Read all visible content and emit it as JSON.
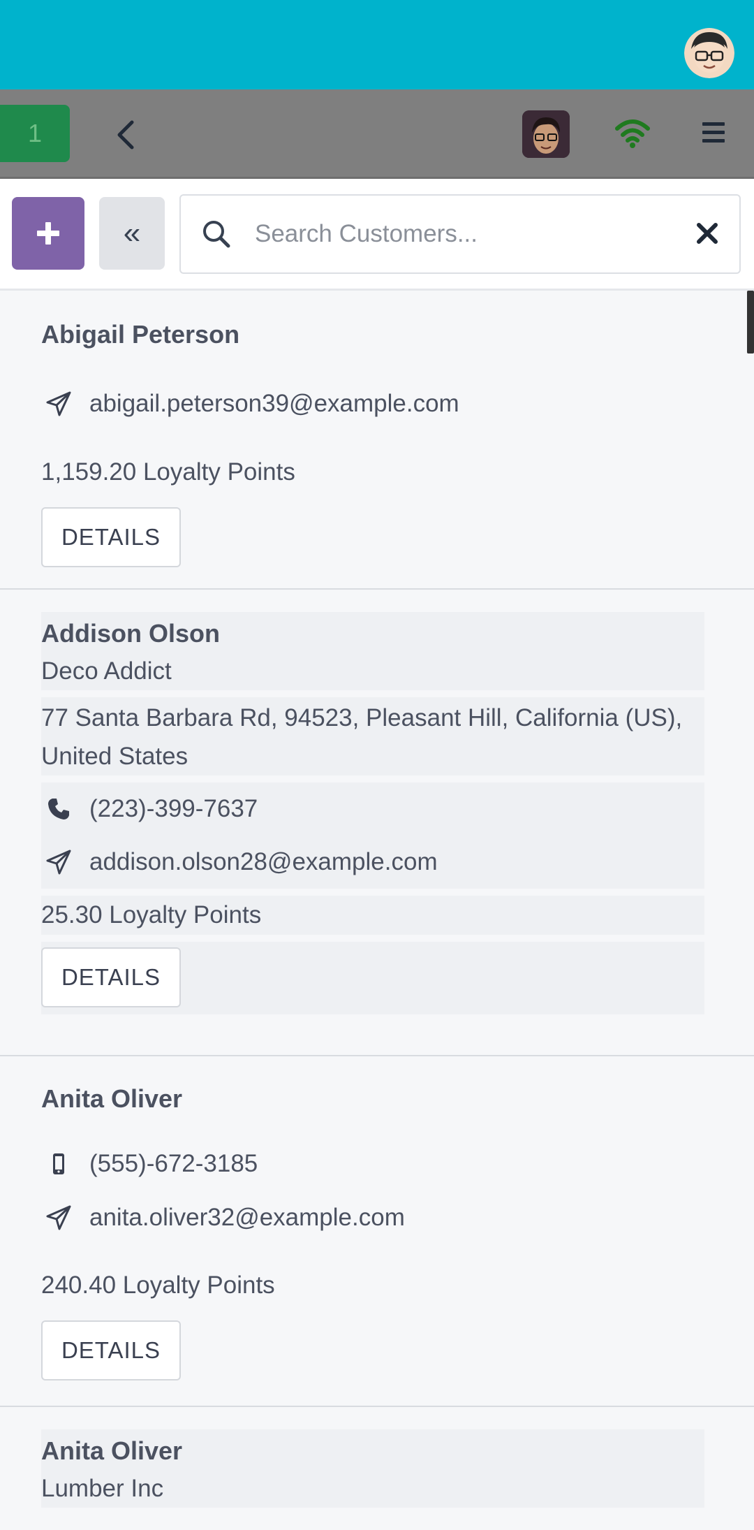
{
  "navbar": {
    "order_count": "1"
  },
  "toolbar": {
    "search_placeholder": "Search Customers...",
    "collapse_label": "«"
  },
  "customers": [
    {
      "name": "Abigail Peterson",
      "email": "abigail.peterson39@example.com",
      "points": "1,159.20 Loyalty Points",
      "details": "DETAILS"
    },
    {
      "name": "Addison Olson",
      "company": "Deco Addict",
      "address_line1": "77 Santa Barbara Rd, 94523, Pleasant Hill, California (US),",
      "address_line2": "United States",
      "phone": "(223)-399-7637",
      "email": "addison.olson28@example.com",
      "points": "25.30 Loyalty Points",
      "details": "DETAILS"
    },
    {
      "name": "Anita Oliver",
      "mobile": "(555)-672-3185",
      "email": "anita.oliver32@example.com",
      "points": "240.40 Loyalty Points",
      "details": "DETAILS"
    },
    {
      "name": "Anita Oliver",
      "company": "Lumber Inc"
    }
  ],
  "icons": {
    "user_avatar": "user-avatar-icon",
    "back": "chevron-left-icon",
    "wifi": "wifi-icon",
    "menu": "hamburger-menu-icon",
    "plus": "plus-icon",
    "search": "search-icon",
    "clear": "close-icon",
    "email": "paper-plane-icon",
    "phone": "phone-icon",
    "mobile": "mobile-phone-icon"
  },
  "colors": {
    "topbar": "#00b3cc",
    "navbar": "#7f7f7f",
    "order_button": "#1f8a4c",
    "new_button": "#7f63a8",
    "wifi": "#1f7a1f"
  }
}
